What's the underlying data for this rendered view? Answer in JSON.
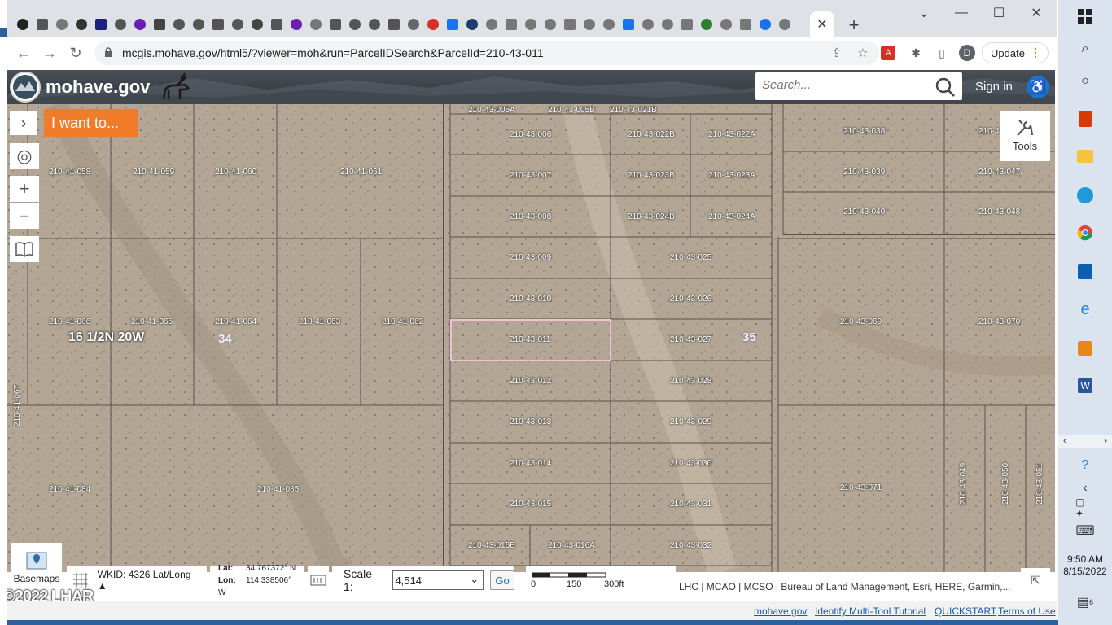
{
  "browser": {
    "url": "mcgis.mohave.gov/html5/?viewer=moh&run=ParcelIDSearch&ParcelId=210-43-011",
    "update_label": "Update",
    "profile_initial": "D",
    "close_tab_glyph": "✕",
    "new_tab_glyph": "+",
    "tab_icon_colors": [
      "#222",
      "#555",
      "#777",
      "#333",
      "#1a237e",
      "#555",
      "#6b1fb1",
      "#444",
      "#555",
      "#555",
      "#555",
      "#555",
      "#444",
      "#555",
      "#6b1fb1",
      "#777",
      "#555",
      "#555",
      "#555",
      "#555",
      "#666",
      "#d93025",
      "#1a73e8",
      "#1f3c6e",
      "#777",
      "#777",
      "#777",
      "#777",
      "#777",
      "#777",
      "#777",
      "#1a73e8",
      "#777",
      "#777",
      "#777",
      "#2e7d32",
      "#777",
      "#777",
      "#1a73e8",
      "#777"
    ]
  },
  "site": {
    "name": "mohave.gov",
    "search_placeholder": "Search...",
    "signin_label": "Sign in",
    "accessibility_glyph": "♿"
  },
  "map": {
    "iwant_label": "I want to...",
    "tools_label": "Tools",
    "basemaps_label": "Basemaps",
    "township_label": "16 1/2N 20W",
    "section_labels": [
      "34",
      "35"
    ],
    "parcels": [
      "210-43-005A",
      "210-43-005B",
      "210-43-021B",
      "210-43-006",
      "210-43-022B",
      "210-43-022A",
      "210-43-038",
      "210-4",
      "210-41-058",
      "210-41-059",
      "210-41-060",
      "210-41-061",
      "210-43-007",
      "210-43-023B",
      "210-43-023A",
      "210-43-039",
      "210-43-047",
      "210-43-008",
      "210-43-024B",
      "210-43-024A",
      "210-43-040",
      "210-43-048",
      "210-43-009",
      "210-43-025",
      "210-43-010",
      "210-43-026",
      "210-41-066",
      "210-41-065",
      "210-41-064",
      "210-41-063",
      "210-41-062",
      "210-43-069",
      "210-43-070",
      "210-43-011",
      "210-43-027",
      "210-43-012",
      "210-43-028",
      "210-41-067",
      "210-43-013",
      "210-43-029",
      "210-43-014",
      "210-43-030",
      "210-41-084",
      "210-41-085",
      "210-43-071",
      "210-43-049",
      "210-43-050",
      "210-43-051",
      "210-43-015",
      "210-43-031",
      "210-43-016B",
      "210-43-016A",
      "210-43-032"
    ],
    "selected_parcel": "210-43-011"
  },
  "statusbar": {
    "wkid": "WKID: 4326 Lat/Long ▲",
    "lat_label": "Lat:",
    "lat_value": "34.767372° N",
    "lon_label": "Lon:",
    "lon_value": "114.338506° W",
    "scale_label": "Scale 1:",
    "scale_value": "4,514",
    "go_label": "Go",
    "scalebar_ticks": [
      "0",
      "150",
      "300ft"
    ],
    "attribution": "LHC | MCAO | MCSO | Bureau of Land Management, Esri, HERE, Garmin,..."
  },
  "copyright": "©2022 LHAR",
  "footer": {
    "links": [
      "mohave.gov",
      "Identify Multi-Tool Tutorial",
      "QUICKSTART",
      "Terms of Use"
    ]
  },
  "taskbar": {
    "time": "9:50 AM",
    "date": "8/15/2022",
    "notification_count": "6"
  },
  "colors": {
    "accent_orange": "#f07c2a",
    "selected_parcel": "#f4c0d8",
    "link_blue": "#1a57b5"
  }
}
